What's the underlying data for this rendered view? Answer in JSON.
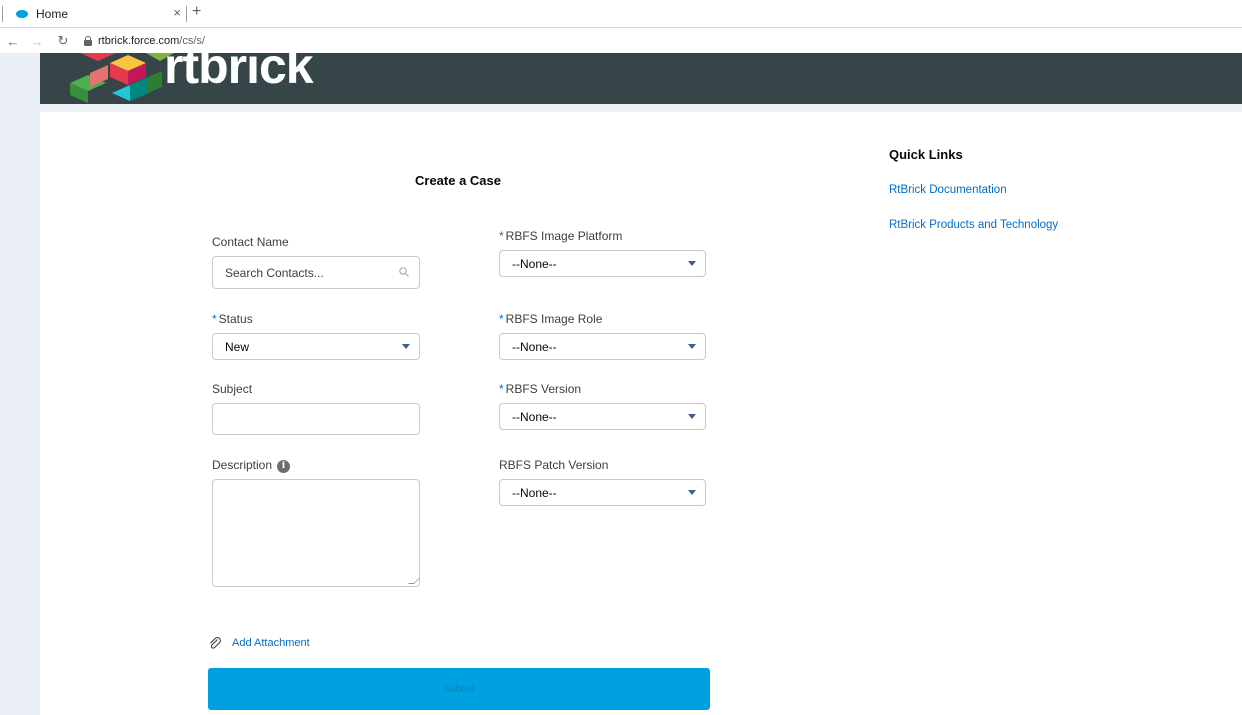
{
  "browser": {
    "tab_title": "Home",
    "tab_close": "×",
    "new_tab": "+",
    "url_host": "rtbrick.force.com",
    "url_path": "/cs/s/"
  },
  "header": {
    "logo_text": "rtbrick"
  },
  "form": {
    "title": "Create a Case",
    "contact_label": "Contact Name",
    "contact_placeholder": "Search Contacts...",
    "status_label": "Status",
    "status_value": "New",
    "subject_label": "Subject",
    "description_label": "Description",
    "platform_label": "RBFS Image Platform",
    "platform_value": "--None--",
    "role_label": "RBFS Image Role",
    "role_value": "--None--",
    "version_label": "RBFS Version",
    "version_value": "--None--",
    "patch_label": "RBFS Patch Version",
    "patch_value": "--None--",
    "required_marker": "*",
    "add_attachment": "Add Attachment",
    "submit_label": "Submit"
  },
  "quick_links": {
    "title": "Quick Links",
    "items": [
      "RtBrick Documentation",
      "RtBrick Products and Technology"
    ]
  },
  "colors": {
    "banner": "#364648",
    "accent": "#00a1e0",
    "link": "#006dcc"
  }
}
